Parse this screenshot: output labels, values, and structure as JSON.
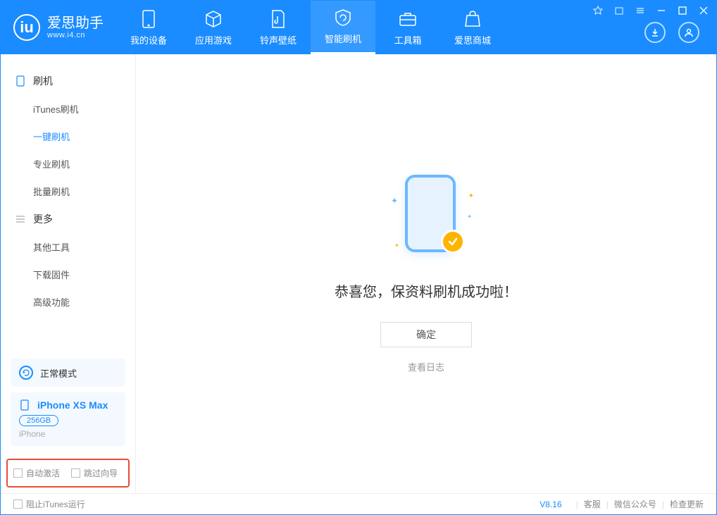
{
  "app": {
    "name": "爱思助手",
    "url": "www.i4.cn"
  },
  "nav": [
    {
      "label": "我的设备"
    },
    {
      "label": "应用游戏"
    },
    {
      "label": "铃声壁纸"
    },
    {
      "label": "智能刷机"
    },
    {
      "label": "工具箱"
    },
    {
      "label": "爱思商城"
    }
  ],
  "sidebar": {
    "section1": {
      "title": "刷机",
      "items": [
        "iTunes刷机",
        "一键刷机",
        "专业刷机",
        "批量刷机"
      ]
    },
    "section2": {
      "title": "更多",
      "items": [
        "其他工具",
        "下载固件",
        "高级功能"
      ]
    }
  },
  "mode": {
    "label": "正常模式"
  },
  "device": {
    "name": "iPhone XS Max",
    "capacity": "256GB",
    "type": "iPhone"
  },
  "options": {
    "opt1": "自动激活",
    "opt2": "跳过向导"
  },
  "result": {
    "title": "恭喜您，保资料刷机成功啦！",
    "ok": "确定",
    "log": "查看日志"
  },
  "status": {
    "block_itunes": "阻止iTunes运行",
    "version": "V8.16",
    "link1": "客服",
    "link2": "微信公众号",
    "link3": "检查更新"
  }
}
